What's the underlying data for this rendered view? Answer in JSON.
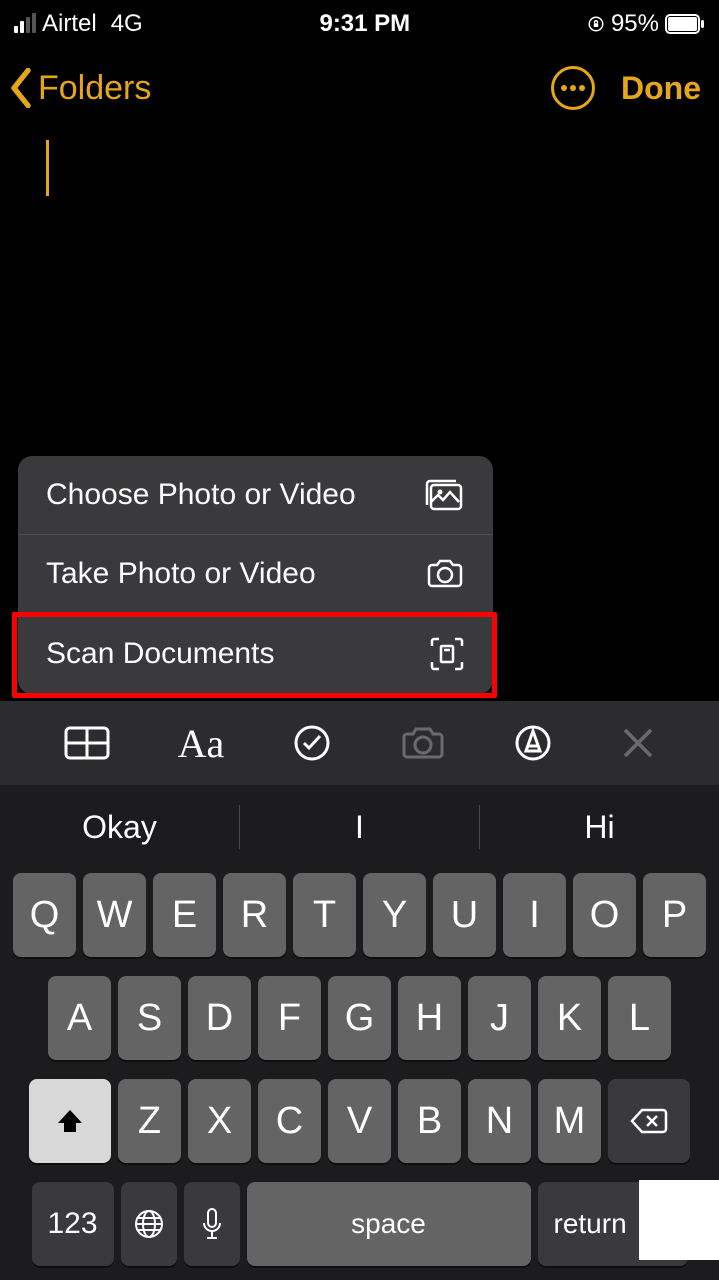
{
  "status": {
    "carrier": "Airtel",
    "network": "4G",
    "time": "9:31 PM",
    "battery": "95%"
  },
  "nav": {
    "back_label": "Folders",
    "done_label": "Done"
  },
  "sheet": {
    "choose": "Choose Photo or Video",
    "take": "Take Photo or Video",
    "scan": "Scan Documents"
  },
  "suggestions": [
    "Okay",
    "I",
    "Hi"
  ],
  "keys": {
    "row1": [
      "Q",
      "W",
      "E",
      "R",
      "T",
      "Y",
      "U",
      "I",
      "O",
      "P"
    ],
    "row2": [
      "A",
      "S",
      "D",
      "F",
      "G",
      "H",
      "J",
      "K",
      "L"
    ],
    "row3": [
      "Z",
      "X",
      "C",
      "V",
      "B",
      "N",
      "M"
    ],
    "num": "123",
    "space": "space",
    "return": "return"
  }
}
